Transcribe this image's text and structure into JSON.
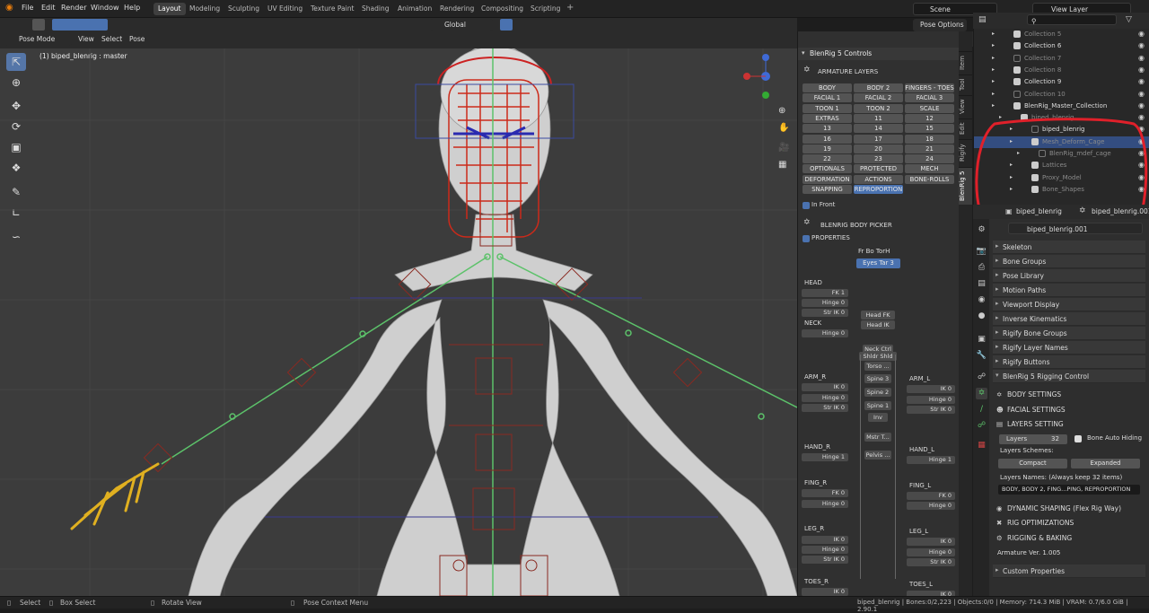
{
  "top_menu": [
    "File",
    "Edit",
    "Render",
    "Window",
    "Help"
  ],
  "workspaces": [
    "Layout",
    "Modeling",
    "Sculpting",
    "UV Editing",
    "Texture Paint",
    "Shading",
    "Animation",
    "Rendering",
    "Compositing",
    "Scripting"
  ],
  "active_workspace": "Layout",
  "scene": "Scene",
  "view_layer": "View Layer",
  "viewport_header": {
    "mode": "Pose Mode",
    "menus": [
      "View",
      "Select",
      "Pose"
    ],
    "orientation": "Global",
    "pose_options": "Pose Options"
  },
  "viewport": {
    "info": "(1) biped_blenrig : master"
  },
  "npanel": {
    "title": "BlenRig 5 Controls",
    "armature_layers_title": "ARMATURE LAYERS",
    "layer_buttons": [
      [
        "BODY",
        "BODY 2",
        "FINGERS - TOES"
      ],
      [
        "FACIAL 1",
        "FACIAL 2",
        "FACIAL 3"
      ],
      [
        "TOON 1",
        "TOON 2",
        "SCALE"
      ],
      [
        "EXTRAS",
        "11",
        "12"
      ],
      [
        "13",
        "14",
        "15"
      ],
      [
        "16",
        "17",
        "18"
      ],
      [
        "19",
        "20",
        "21"
      ],
      [
        "22",
        "23",
        "24"
      ],
      [
        "OPTIONALS",
        "PROTECTED",
        "MECH"
      ],
      [
        "DEFORMATION",
        "ACTIONS",
        "BONE-ROLLS"
      ],
      [
        "SNAPPING",
        "REPROPORTION",
        ""
      ]
    ],
    "in_front": "In Front",
    "body_picker_title": "BLENRIG BODY PICKER",
    "properties_label": "PROPERTIES",
    "fr_bo_tor": "Fr  Bo  TorH",
    "eyes_tar": "Eyes Tar   3",
    "picker": {
      "head": "HEAD",
      "fk1": "FK 1",
      "hinge0": "Hinge 0",
      "strik0": "Str IK 0",
      "neck": "NECK",
      "arm_r": "ARM_R",
      "arm_l": "ARM_L",
      "ik0": "IK 0",
      "hand_r": "HAND_R",
      "hand_l": "HAND_L",
      "hinge1": "Hinge 1",
      "fing_r": "FING_R",
      "fing_l": "FING_L",
      "fk0": "FK 0",
      "leg_r": "LEG_R",
      "leg_l": "LEG_L",
      "toes_r": "TOES_R",
      "toes_l": "TOES_L",
      "center": [
        "Head FK",
        "Head IK",
        "Neck Ctrl",
        "Shldr Shld",
        "Torso ...",
        "Spine 3",
        "Spine 2",
        "Spine 1",
        "Inv",
        "Mstr T...",
        "Pelvis ..."
      ]
    }
  },
  "side_tabs": [
    "Item",
    "Tool",
    "View",
    "Edit",
    "Rigify",
    "BlenRig 5"
  ],
  "outliner": {
    "rows": [
      {
        "label": "Collection 5",
        "checked": true,
        "dim": true
      },
      {
        "label": "Collection 6",
        "checked": true,
        "dim": false
      },
      {
        "label": "Collection 7",
        "checked": false,
        "dim": true
      },
      {
        "label": "Collection 8",
        "checked": true,
        "dim": true
      },
      {
        "label": "Collection 9",
        "checked": true,
        "dim": false
      },
      {
        "label": "Collection 10",
        "checked": false,
        "dim": true
      },
      {
        "label": "BlenRig_Master_Collection",
        "checked": true,
        "dim": false
      },
      {
        "label": "biped_blenrig",
        "checked": true,
        "dim": true
      },
      {
        "label": "biped_blenrig",
        "checked": false,
        "dim": false
      },
      {
        "label": "Mesh_Deform_Cage",
        "checked": true,
        "dim": true,
        "selected": true
      },
      {
        "label": "BlenRig_mdef_cage",
        "checked": false,
        "dim": true
      },
      {
        "label": "Lattices",
        "checked": true,
        "dim": true
      },
      {
        "label": "Proxy_Model",
        "checked": true,
        "dim": true
      },
      {
        "label": "Bone_Shapes",
        "checked": true,
        "dim": true
      }
    ]
  },
  "properties": {
    "object_name": "biped_blenrig",
    "armature_name": "biped_blenrig.001",
    "data_field": "biped_blenrig.001",
    "sections": [
      "Skeleton",
      "Bone Groups",
      "Pose Library",
      "Motion Paths",
      "Viewport Display",
      "Inverse Kinematics",
      "Rigify Bone Groups",
      "Rigify Layer Names",
      "Rigify Buttons",
      "BlenRig 5 Rigging Control"
    ],
    "body_settings": "BODY SETTINGS",
    "facial_settings": "FACIAL SETTINGS",
    "layers_setting": "LAYERS SETTING",
    "layers_label": "Layers",
    "layers_value": "32",
    "bone_auto_hiding": "Bone Auto Hiding",
    "layers_schemes": "Layers Schemes:",
    "compact": "Compact",
    "expanded": "Expanded",
    "layers_names": "Layers Names: (Always keep 32 items)",
    "layers_names_value": "BODY, BODY 2, FING...PING, REPROPORTION",
    "dynamic_shaping": "DYNAMIC SHAPING (Flex Rig Way)",
    "rig_optimizations": "RIG OPTIMIZATIONS",
    "rigging_baking": "RIGGING & BAKING",
    "armature_ver": "Armature Ver. 1.005",
    "custom_properties": "Custom Properties"
  },
  "statusbar": {
    "select": "Select",
    "box_select": "Box Select",
    "rotate_view": "Rotate View",
    "pose_context": "Pose Context Menu",
    "info": "biped_blenrig | Bones:0/2,223 | Objects:0/0 | Memory: 714.3 MiB | VRAM: 0.7/6.0 GiB | 2.90.1"
  },
  "colors": {
    "accent": "#4a72b0",
    "annotation": "#e0202a",
    "bone_green": "#5cc26a",
    "bone_red": "#cc2a1a",
    "bone_blue": "#2a2ab0",
    "bone_yellow": "#e0b020"
  }
}
